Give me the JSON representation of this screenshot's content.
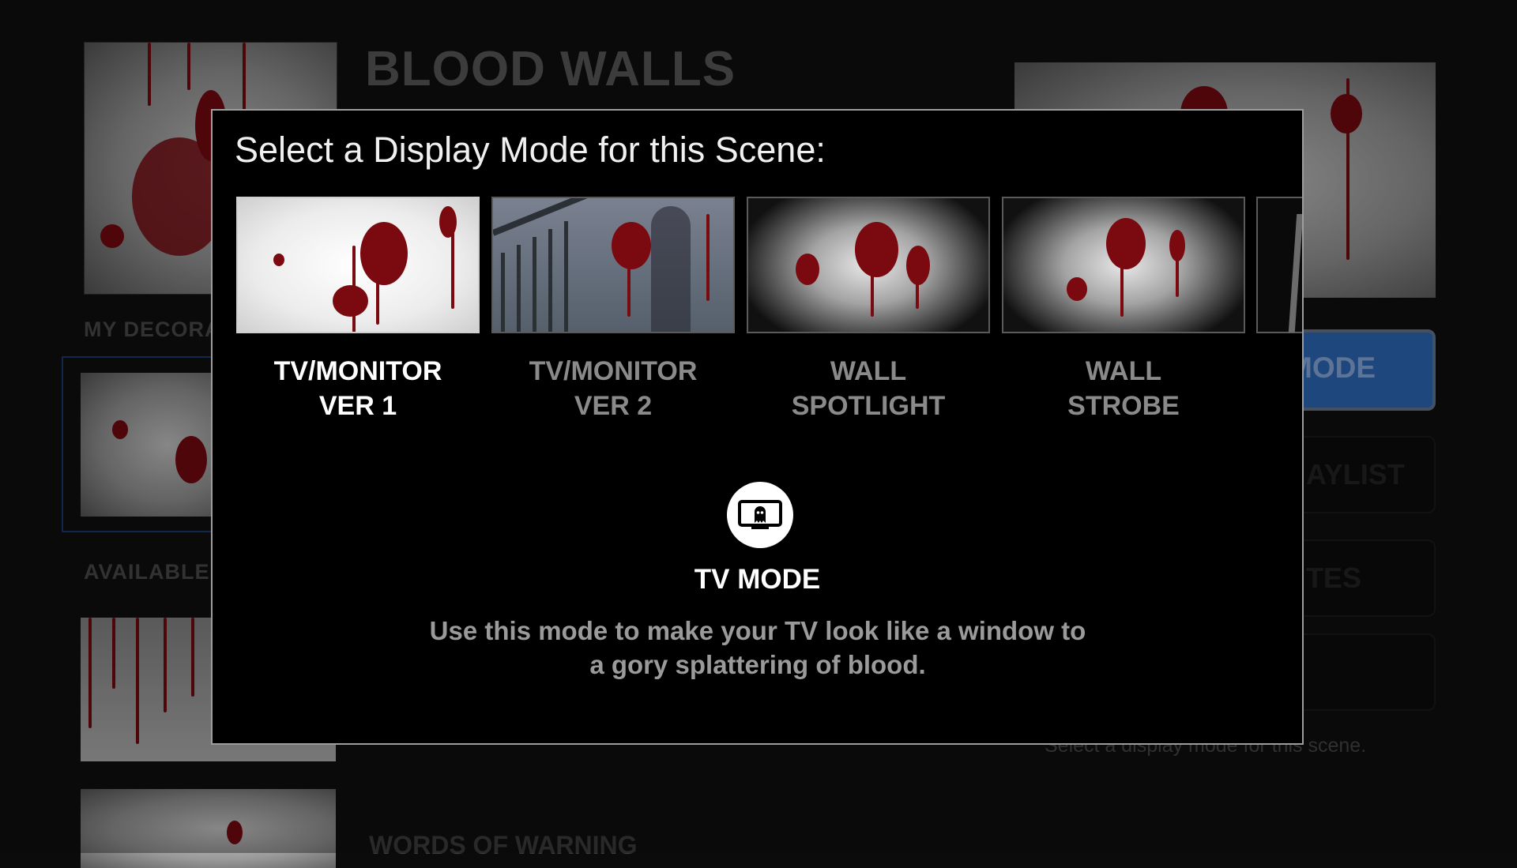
{
  "page": {
    "title": "BLOOD WALLS",
    "section_decorations": "MY DECORA",
    "section_available": "AVAILABLE F",
    "section_warning": "WORDS OF WARNING",
    "hint": "Select a display mode for this scene."
  },
  "side_buttons": {
    "mode": "MODE",
    "playlist": "AYLIST",
    "notes": "TES"
  },
  "modal": {
    "title": "Select a Display Mode for this Scene:",
    "options": [
      {
        "line1": "TV/MONITOR",
        "line2": "VER 1",
        "selected": true
      },
      {
        "line1": "TV/MONITOR",
        "line2": "VER 2",
        "selected": false
      },
      {
        "line1": "WALL",
        "line2": "SPOTLIGHT",
        "selected": false
      },
      {
        "line1": "WALL",
        "line2": "STROBE",
        "selected": false
      }
    ],
    "selected_mode": {
      "icon": "ghost-tv-icon",
      "name": "TV MODE",
      "description_line1": "Use this mode to make your TV look like a window to",
      "description_line2": "a gory splattering of blood."
    }
  },
  "colors": {
    "accent_blue": "#2f6dc0",
    "blood": "#7a0a10",
    "modal_border": "#9d9d9d"
  }
}
